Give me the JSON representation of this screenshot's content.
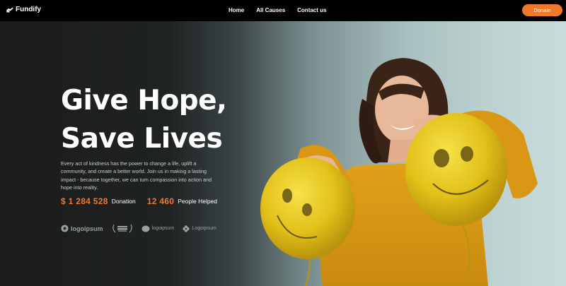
{
  "brand": {
    "name": "Fundify",
    "icon": "hand-heart-icon"
  },
  "nav": {
    "links": [
      "Home",
      "All Causes",
      "Contact us"
    ],
    "donate_label": "Donate"
  },
  "hero": {
    "headline_line1": "Give Hope,",
    "headline_line2": "Save Lives",
    "description": "Every act of kindness has the power to change a life, uplift a community, and create a better world. Join us in making a lasting impact - because together, we can turn compassion into action and hope into reality.",
    "stats": [
      {
        "value": "$ 1 284 528",
        "label": "Donation"
      },
      {
        "value": "12 460",
        "label": "People Helped"
      }
    ],
    "partner_logos": [
      "logoipsum",
      "logoipsum",
      "logoipsum",
      "Logoipsum"
    ]
  },
  "colors": {
    "accent": "#f07a2c",
    "nav_bg": "#000000"
  }
}
